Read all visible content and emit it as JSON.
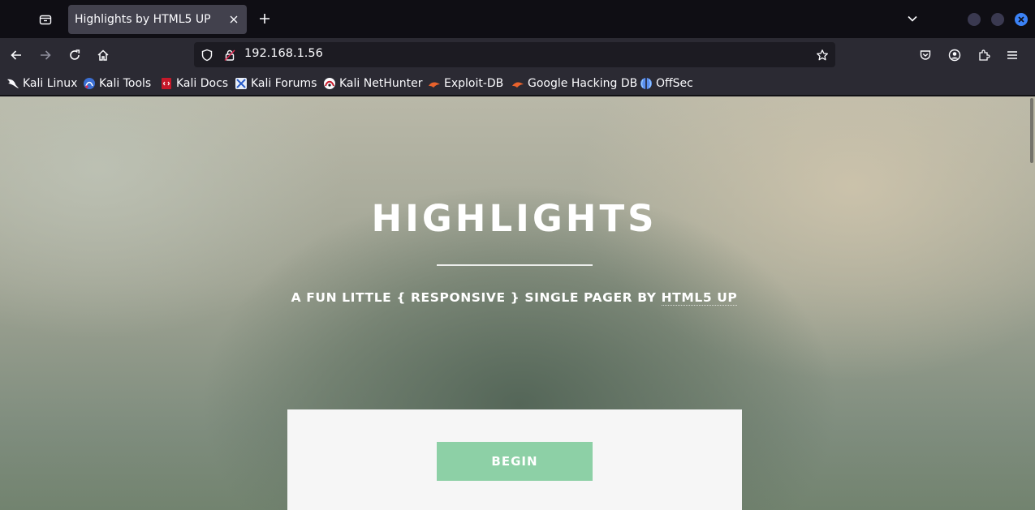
{
  "browser": {
    "tab": {
      "title": "Highlights by HTML5 UP"
    },
    "url": "192.168.1.56",
    "bookmarks": [
      {
        "label": "Kali Linux",
        "icon": "kali-dragon-icon"
      },
      {
        "label": "Kali Tools",
        "icon": "kali-tools-icon"
      },
      {
        "label": "Kali Docs",
        "icon": "kali-docs-icon"
      },
      {
        "label": "Kali Forums",
        "icon": "kali-forums-icon"
      },
      {
        "label": "Kali NetHunter",
        "icon": "kali-nethunter-icon"
      },
      {
        "label": "Exploit-DB",
        "icon": "exploit-db-icon"
      },
      {
        "label": "Google Hacking DB",
        "icon": "ghdb-icon"
      },
      {
        "label": "OffSec",
        "icon": "offsec-icon"
      }
    ]
  },
  "page": {
    "title": "HIGHLIGHTS",
    "subtitle_prefix": "A FUN LITTLE { RESPONSIVE } SINGLE PAGER BY",
    "subtitle_link": "HTML5 UP",
    "begin_label": "BEGIN",
    "accent_color": "#8dd0a6"
  }
}
